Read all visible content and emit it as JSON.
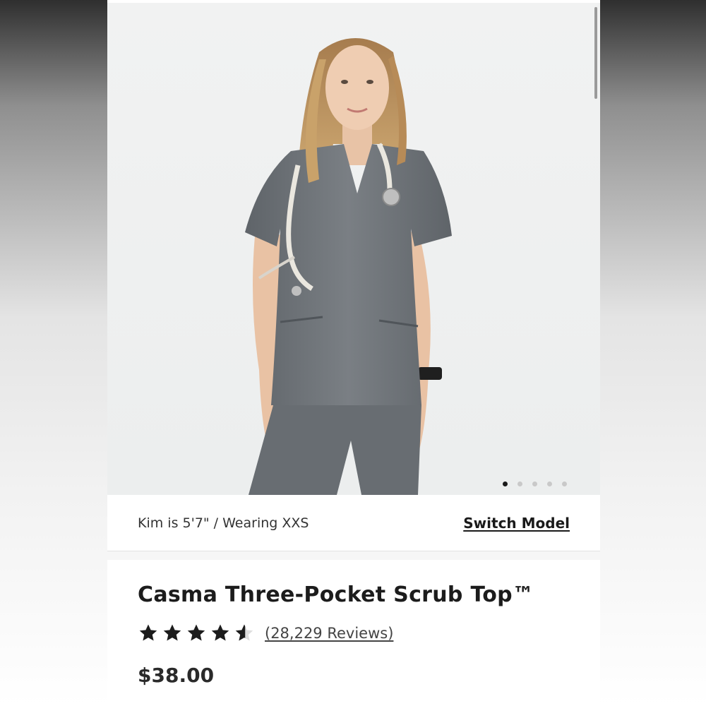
{
  "product_gallery": {
    "image_alt": "Model wearing grey scrub top with stethoscope",
    "slide_count": 5,
    "active_slide": 1
  },
  "model_bar": {
    "info": "Kim is 5'7\" / Wearing XXS",
    "switch_label": "Switch Model"
  },
  "product": {
    "title": "Casma Three-Pocket Scrub Top™",
    "rating": 4.6,
    "rating_max": 5,
    "reviews_label": "(28,229 Reviews)",
    "price": "$38.00"
  },
  "colors": {
    "scrub": "#6f7479",
    "text": "#1c1c1c",
    "background": "#eef0f0"
  }
}
